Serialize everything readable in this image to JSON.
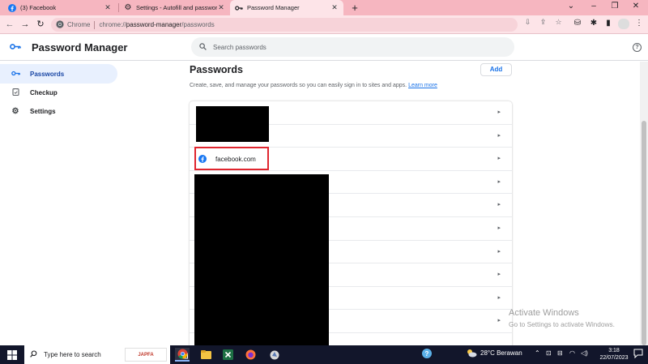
{
  "browser": {
    "tabs": [
      {
        "title": "(3) Facebook",
        "icon": "facebook-icon",
        "active": false
      },
      {
        "title": "Settings - Autofill and passwords",
        "icon": "gear-icon",
        "active": false
      },
      {
        "title": "Password Manager",
        "icon": "key-icon",
        "active": true
      }
    ],
    "omnibox": {
      "chip": "Chrome",
      "url_scheme": "chrome://",
      "url_host": "password-manager",
      "url_path": "/passwords"
    }
  },
  "app": {
    "title": "Password Manager",
    "search_placeholder": "Search passwords"
  },
  "sidebar": {
    "items": [
      {
        "label": "Passwords",
        "icon": "key-icon",
        "active": true
      },
      {
        "label": "Checkup",
        "icon": "checkup-icon",
        "active": false
      },
      {
        "label": "Settings",
        "icon": "gear-icon",
        "active": false
      }
    ]
  },
  "main": {
    "title": "Passwords",
    "add_label": "Add",
    "description": "Create, save, and manage your passwords so you can easily sign in to sites and apps.",
    "learn_more": "Learn more",
    "rows": [
      {
        "site": ""
      },
      {
        "site": ""
      },
      {
        "site": "facebook.com",
        "icon": "facebook-icon"
      },
      {
        "site": ""
      },
      {
        "site": ""
      },
      {
        "site": ""
      },
      {
        "site": ""
      },
      {
        "site": ""
      },
      {
        "site": ""
      },
      {
        "site": ""
      }
    ]
  },
  "watermark": {
    "line1": "Activate Windows",
    "line2": "Go to Settings to activate Windows."
  },
  "taskbar": {
    "search_placeholder": "Type here to search",
    "search_badge": "JAPFA",
    "weather": "28°C  Berawan",
    "time": "3:18",
    "date": "22/07/2023"
  },
  "colors": {
    "tabstrip": "#f6b6c0",
    "toolbar": "#fde4e8",
    "accent": "#1a73e8",
    "highlight": "#e0262f",
    "taskbar": "#12162b"
  }
}
